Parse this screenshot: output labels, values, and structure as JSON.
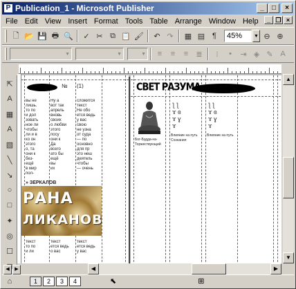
{
  "window": {
    "title": "Publication_1 - Microsoft Publisher",
    "app_icon": "P"
  },
  "menu": [
    "File",
    "Edit",
    "View",
    "Insert",
    "Format",
    "Tools",
    "Table",
    "Arrange",
    "Window",
    "Help"
  ],
  "toolbar": {
    "zoom_value": "45%"
  },
  "publication": {
    "left_page": {
      "issue_label": "№",
      "issue_number": "(1)",
      "section_label": "» ЗЕРКАЛОВ",
      "banner_line1": "РАНА",
      "banner_line2": "ЛИКАНОВ"
    },
    "right_page": {
      "headline": "СВЕТ РАЗУМА",
      "caption_buddha": "Бог-Будда-на-Торжествующий",
      "caption_col2": "Влияние на путь Сознания",
      "caption_col3": "Влияние на путь"
    }
  },
  "status": {
    "pages": [
      "1",
      "2",
      "3",
      "4"
    ],
    "active_page": "1"
  },
  "colors": {
    "titlebar": "#0a246a",
    "guides": "#4a5ad8",
    "banner": "#b5914a"
  }
}
